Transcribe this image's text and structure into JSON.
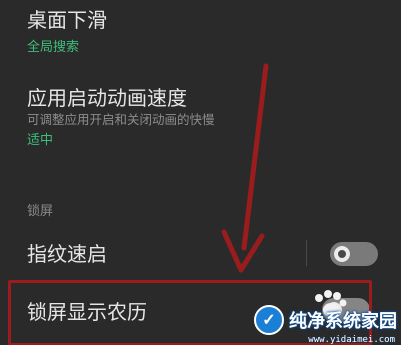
{
  "settings": {
    "desktop_swipe": {
      "title": "桌面下滑",
      "value": "全局搜索"
    },
    "app_animation": {
      "title": "应用启动动画速度",
      "description": "可调整应用开启和关闭动画的快慢",
      "value": "适中"
    },
    "lock_section": {
      "header": "锁屏"
    },
    "fingerprint_quick": {
      "title": "指纹速启",
      "toggle_state": "off"
    },
    "lunar_calendar": {
      "title": "锁屏显示农历",
      "toggle_state": "off"
    }
  },
  "colors": {
    "background": "#2a2a2a",
    "accent_green": "#3cbf7a",
    "annotation_red": "#9b1c1c"
  },
  "watermark": {
    "logo_text": "✓",
    "text": "纯净系统家园",
    "url": "www.yidaimei.com"
  }
}
